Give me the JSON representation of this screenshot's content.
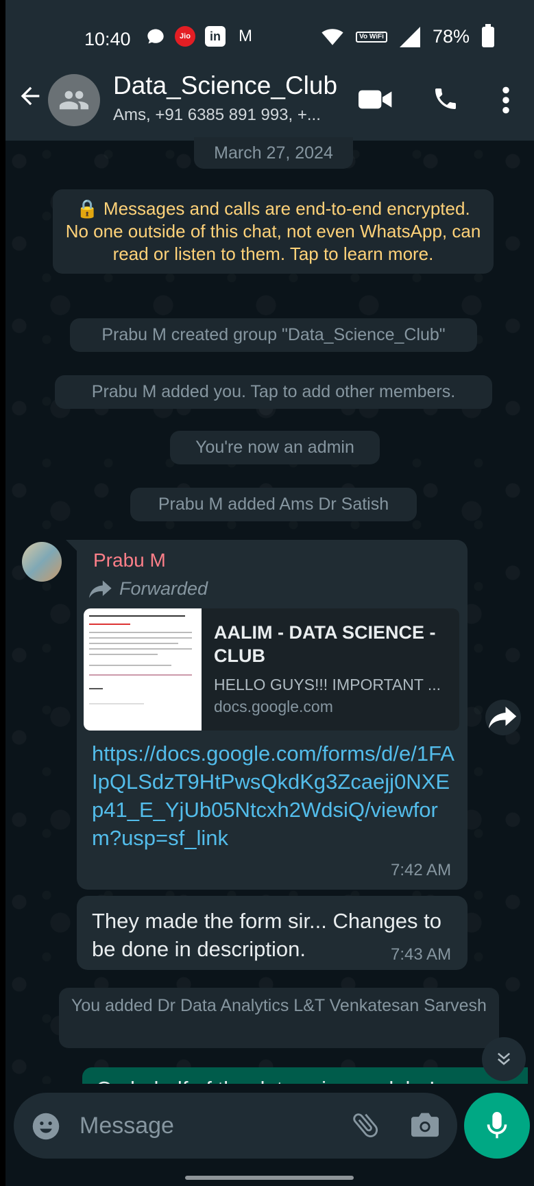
{
  "status_bar": {
    "time": "10:40",
    "carrier_badge": "Jio",
    "linkedin_badge": "in",
    "gmail_badge": "M",
    "vowifi": "Vo WiFi",
    "battery": "78%"
  },
  "header": {
    "title": "Data_Science_Club",
    "subtitle": "Ams, +91 6385 891 993, +..."
  },
  "chat": {
    "date_pill": "March 27, 2024",
    "encryption_notice": "🔒 Messages and calls are end-to-end encrypted. No one outside of this chat, not even WhatsApp, can read or listen to them. Tap to learn more.",
    "system_messages": [
      "Prabu M created group \"Data_Science_Club\"",
      "Prabu M added you. Tap to add other members.",
      "You're now an admin",
      "Prabu M added Ams Dr Satish",
      "You added Dr Data Analytics L&T Venkatesan Sarvesh"
    ],
    "message1": {
      "sender": "Prabu M",
      "forwarded_label": "Forwarded",
      "preview_title": "AALIM - DATA SCIENCE - CLUB",
      "preview_desc": "HELLO GUYS!!! IMPORTANT ...",
      "preview_domain": "docs.google.com",
      "link": "https://docs.google.com/forms/d/e/1FAIpQLSdzT9HtPwsQkdKg3Zcaejj0NXEp41_E_YjUb05Ntcxh2WdsiQ/viewform?usp=sf_link",
      "time": "7:42 AM"
    },
    "message2": {
      "text": "They made the form sir... Changes to be done in description.",
      "time": "7:43 AM"
    },
    "outgoing_partial": "On behalf of the data science club, I"
  },
  "composer": {
    "placeholder": "Message"
  },
  "colors": {
    "header_bg": "#1f2c34",
    "chat_bg": "#0b141a",
    "accent": "#00a884",
    "sender_name": "#fd7f89",
    "link": "#53bdeb",
    "encryption_text": "#ffd279"
  }
}
